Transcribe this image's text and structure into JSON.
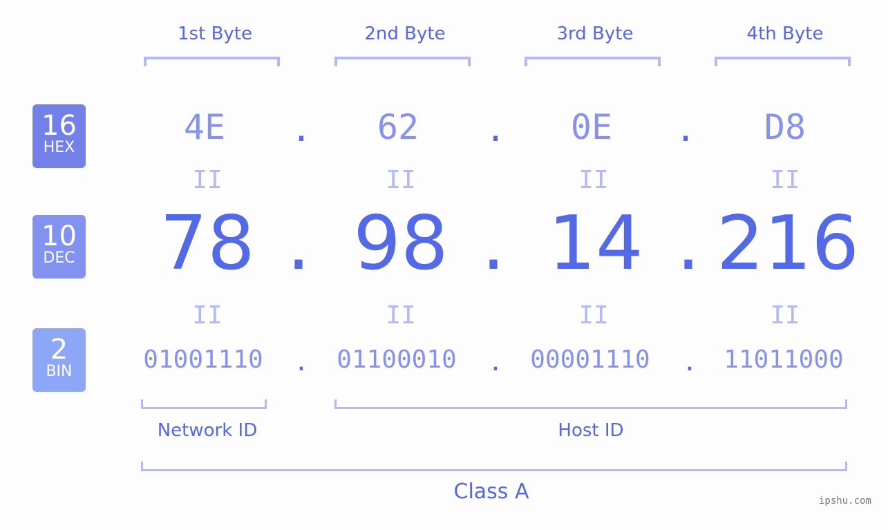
{
  "byte_headers": [
    "1st Byte",
    "2nd Byte",
    "3rd Byte",
    "4th Byte"
  ],
  "badges": [
    {
      "num": "16",
      "label": "HEX",
      "color": "#7480ea"
    },
    {
      "num": "10",
      "label": "DEC",
      "color": "#8391f0"
    },
    {
      "num": "2",
      "label": "BIN",
      "color": "#8ea6f8"
    }
  ],
  "hex": [
    "4E",
    "62",
    "0E",
    "D8"
  ],
  "dec": [
    "78",
    "98",
    "14",
    "216"
  ],
  "bin": [
    "01001110",
    "01100010",
    "00001110",
    "11011000"
  ],
  "separator": ".",
  "equals": "II",
  "network_id_label": "Network ID",
  "host_id_label": "Host ID",
  "class_label": "Class A",
  "watermark": "ipshu.com"
}
